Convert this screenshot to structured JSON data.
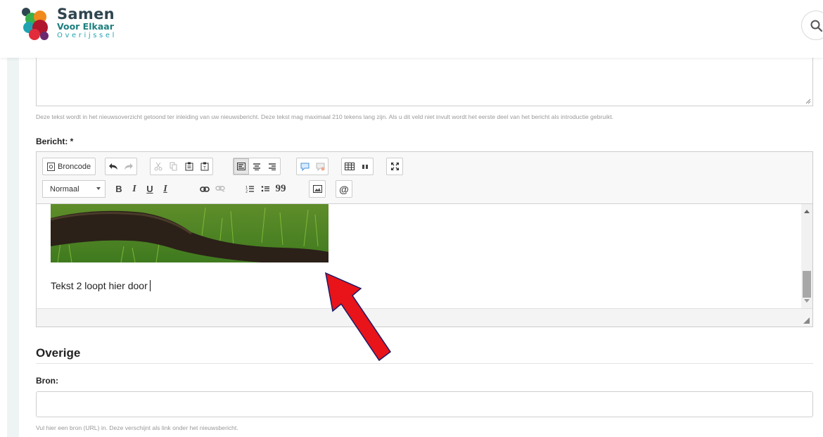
{
  "header": {
    "logo": {
      "line1": "Samen",
      "line2": "Voor Elkaar",
      "line3": "Overijssel"
    },
    "search_icon": "search-icon"
  },
  "form": {
    "intro_help": "Deze tekst wordt in het nieuwsoverzicht getoond ter inleiding van uw nieuwsbericht. Deze tekst mag maximaal 210 tekens lang zijn. Als u dit veld niet invult wordt het eerste deel van het bericht als introductie gebruikt.",
    "message_label": "Bericht: *",
    "editor": {
      "toolbar": {
        "source_label": "Broncode",
        "format_value": "Normaal",
        "bold": "B",
        "italic": "I",
        "underline": "U",
        "remove_format": "I",
        "blockquote": "99",
        "mention": "@"
      },
      "content_text": "Tekst 2 loopt hier door"
    },
    "section_title": "Overige",
    "source_label": "Bron:",
    "source_value": "",
    "source_help": "Vul hier een bron (URL) in. Deze verschijnt als link onder het nieuwsbericht."
  },
  "colors": {
    "brand_dark": "#2f4550",
    "brand_teal": "#1e7e7e",
    "annotation_arrow": "#e8141a"
  }
}
